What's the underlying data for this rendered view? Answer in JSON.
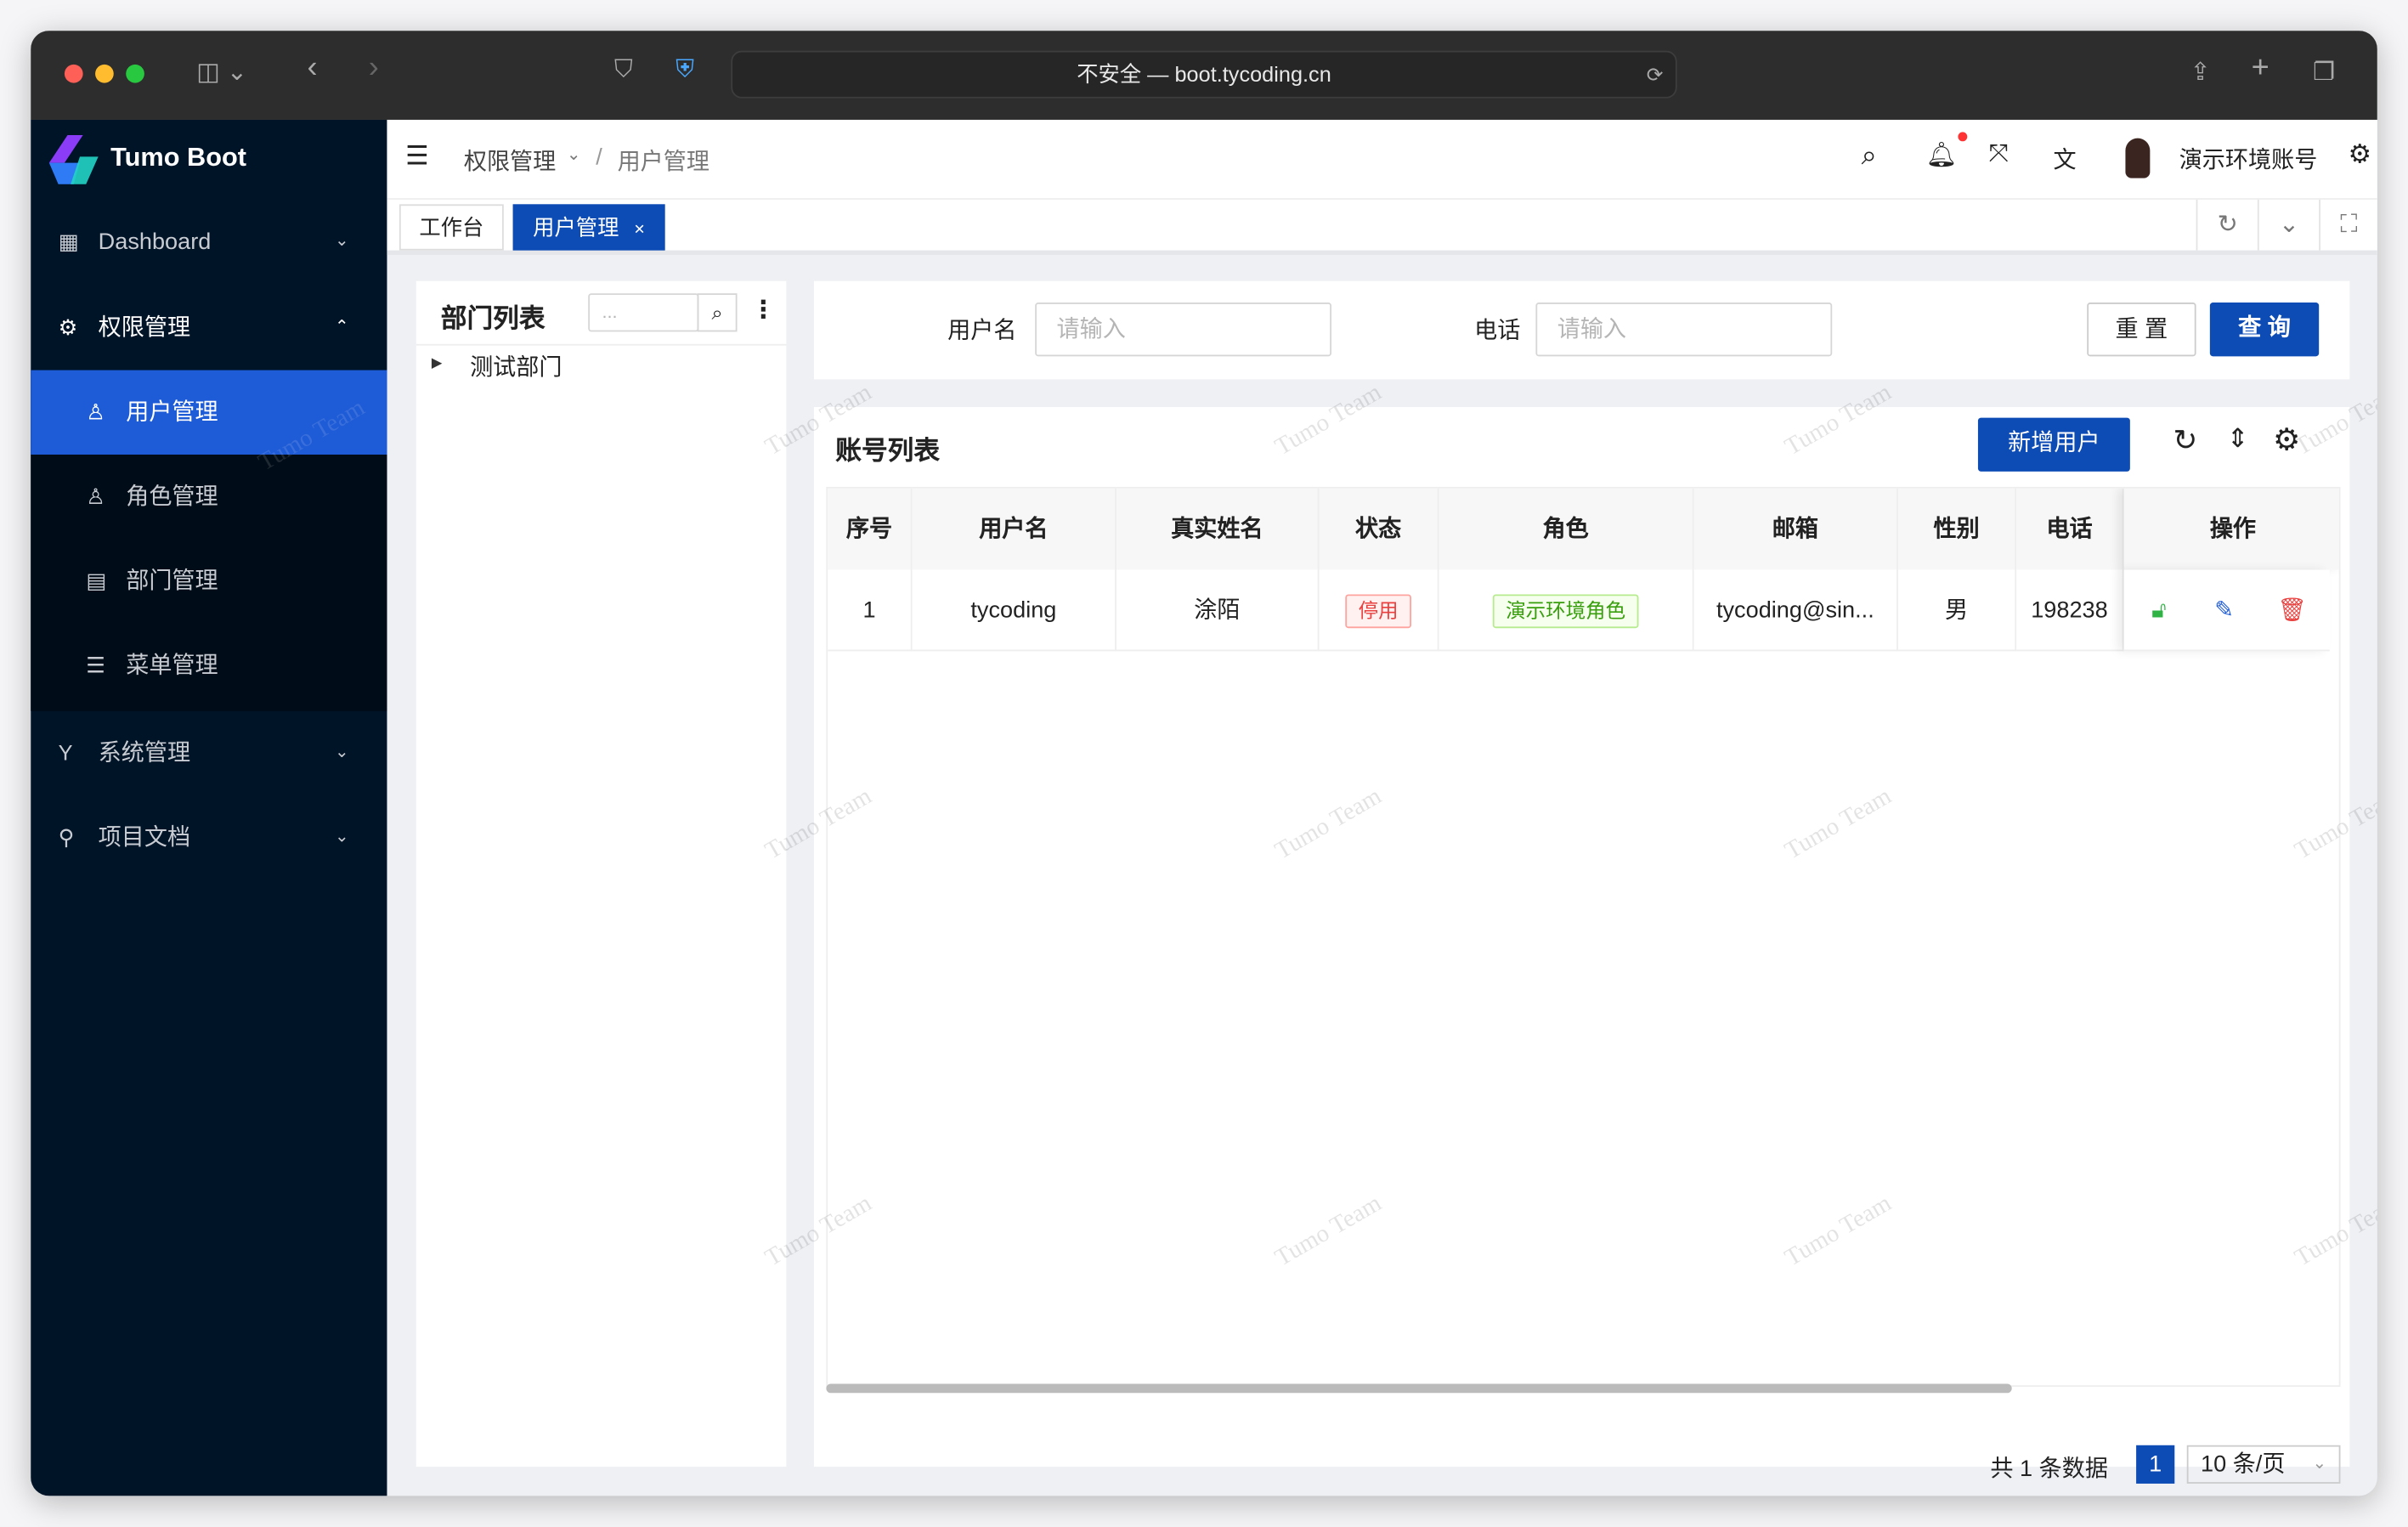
{
  "browser": {
    "url_text": "不安全 — boot.tycoding.cn"
  },
  "sidebar": {
    "brand": "Tumo Boot",
    "items": [
      {
        "label": "Dashboard",
        "icon": "dashboard-icon"
      },
      {
        "label": "权限管理",
        "icon": "gear-icon",
        "expanded": true,
        "children": [
          {
            "label": "用户管理",
            "icon": "user-icon",
            "active": true
          },
          {
            "label": "角色管理",
            "icon": "role-icon"
          },
          {
            "label": "部门管理",
            "icon": "dept-icon"
          },
          {
            "label": "菜单管理",
            "icon": "list-icon"
          }
        ]
      },
      {
        "label": "系统管理",
        "icon": "branch-icon"
      },
      {
        "label": "项目文档",
        "icon": "rocket-icon"
      }
    ]
  },
  "header": {
    "breadcrumb": [
      "权限管理",
      "用户管理"
    ],
    "username": "演示环境账号"
  },
  "tabs": [
    {
      "label": "工作台"
    },
    {
      "label": "用户管理",
      "active": true,
      "close": "×"
    }
  ],
  "dept": {
    "title": "部门列表",
    "search_placeholder": "...",
    "tree": [
      "测试部门"
    ]
  },
  "search": {
    "username_label": "用户名",
    "username_placeholder": "请输入",
    "phone_label": "电话",
    "phone_placeholder": "请输入",
    "reset": "重 置",
    "query": "查 询"
  },
  "table": {
    "title": "账号列表",
    "add_button": "新增用户",
    "columns": [
      "序号",
      "用户名",
      "真实姓名",
      "状态",
      "角色",
      "邮箱",
      "性别",
      "电话",
      "操作"
    ],
    "rows": [
      {
        "index": "1",
        "username": "tycoding",
        "realname": "涂陌",
        "status": "停用",
        "role": "演示环境角色",
        "email": "tycoding@sin...",
        "sex": "男",
        "phone": "198238"
      }
    ],
    "total_text": "共 1 条数据",
    "page": "1",
    "page_size": "10 条/页"
  },
  "watermark": "Tumo Team",
  "colors": {
    "primary": "#0d4bb5",
    "sidebar": "#001428",
    "active_menu": "#1e5bd6",
    "danger": "#e8413f",
    "success": "#389e0d"
  }
}
